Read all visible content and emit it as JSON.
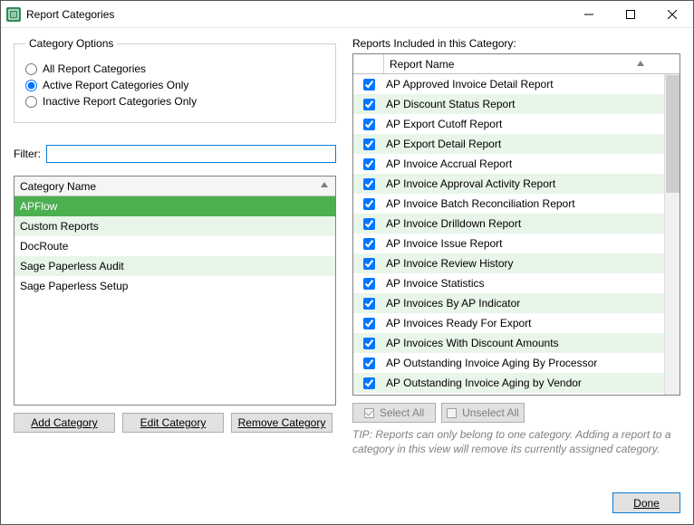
{
  "window": {
    "title": "Report Categories"
  },
  "options": {
    "legend": "Category Options",
    "all": "All Report Categories",
    "active": "Active Report Categories Only",
    "inactive": "Inactive Report Categories Only",
    "selected": "active"
  },
  "filter": {
    "label": "Filter:",
    "value": ""
  },
  "categories": {
    "header": "Category Name",
    "items": [
      {
        "name": "APFlow",
        "selected": true
      },
      {
        "name": "Custom Reports"
      },
      {
        "name": "DocRoute"
      },
      {
        "name": "Sage Paperless Audit"
      },
      {
        "name": "Sage Paperless Setup"
      }
    ]
  },
  "cat_buttons": {
    "add": "Add Category",
    "edit": "Edit Category",
    "remove": "Remove Category"
  },
  "reports": {
    "label": "Reports Included in this Category:",
    "header": "Report Name",
    "items": [
      {
        "name": "AP Approved Invoice Detail Report",
        "checked": true
      },
      {
        "name": "AP Discount Status Report",
        "checked": true
      },
      {
        "name": "AP Export Cutoff Report",
        "checked": true
      },
      {
        "name": "AP Export Detail Report",
        "checked": true
      },
      {
        "name": "AP Invoice Accrual Report",
        "checked": true
      },
      {
        "name": "AP Invoice Approval Activity Report",
        "checked": true
      },
      {
        "name": "AP Invoice Batch Reconciliation Report",
        "checked": true
      },
      {
        "name": "AP Invoice Drilldown Report",
        "checked": true
      },
      {
        "name": "AP Invoice Issue Report",
        "checked": true
      },
      {
        "name": "AP Invoice Review History",
        "checked": true
      },
      {
        "name": "AP Invoice Statistics",
        "checked": true
      },
      {
        "name": "AP Invoices By AP Indicator",
        "checked": true
      },
      {
        "name": "AP Invoices Ready For Export",
        "checked": true
      },
      {
        "name": "AP Invoices With Discount Amounts",
        "checked": true
      },
      {
        "name": "AP Outstanding Invoice Aging By Processor",
        "checked": true
      },
      {
        "name": "AP Outstanding Invoice Aging by Vendor",
        "checked": true
      }
    ]
  },
  "sel_buttons": {
    "select_all": "Select All",
    "unselect_all": "Unselect All"
  },
  "tip": "TIP:  Reports can only belong to one category.  Adding a report to a category in this view will remove its currently assigned category.",
  "done": "Done"
}
